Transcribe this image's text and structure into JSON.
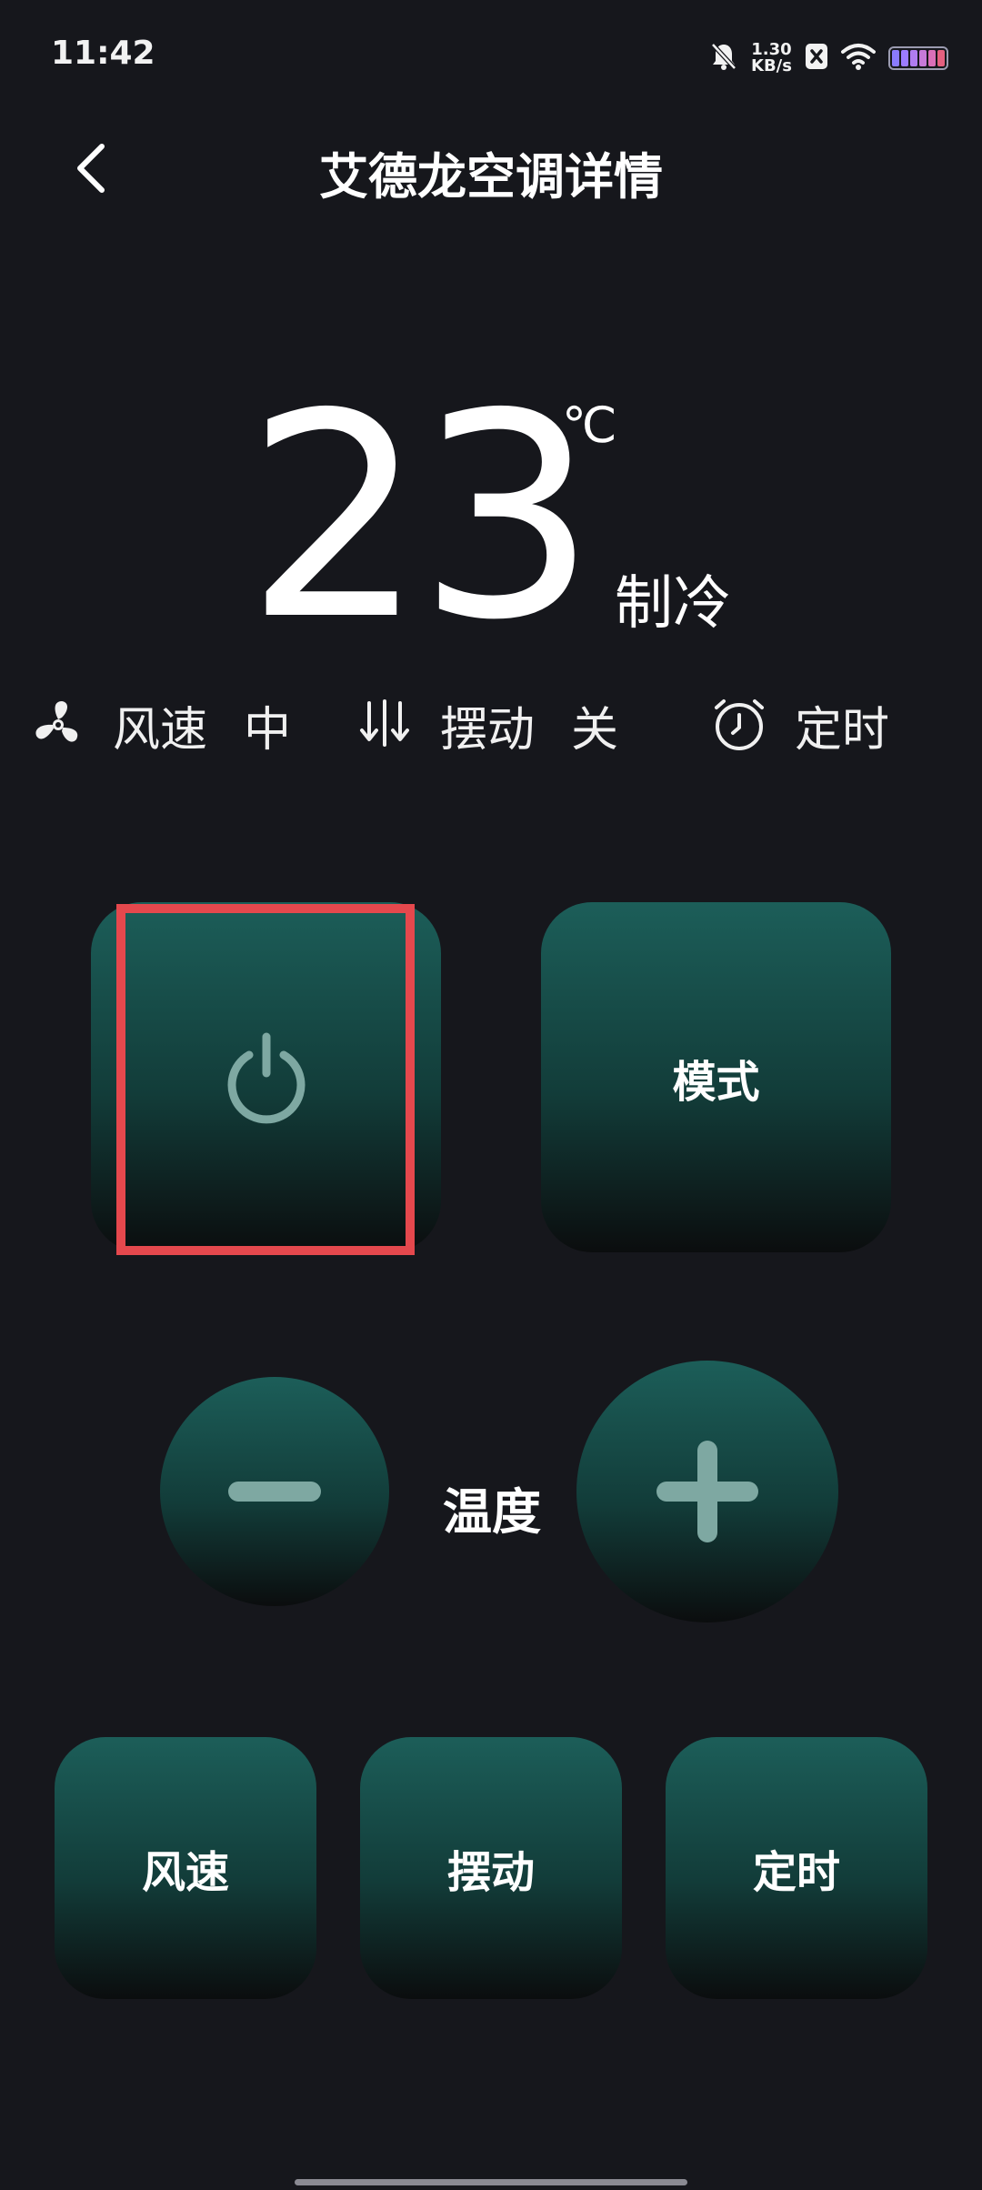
{
  "status_bar": {
    "time": "11:42",
    "net_speed_value": "1.30",
    "net_speed_unit": "KB/s",
    "battery_colors": [
      "#8a7bff",
      "#9c7cff",
      "#b07cf0",
      "#c77ad8",
      "#da6fb8",
      "#e4607f"
    ]
  },
  "header": {
    "title": "艾德龙空调详情"
  },
  "ac_status": {
    "temperature": "23",
    "unit": "℃",
    "mode": "制冷"
  },
  "info_row": {
    "fan_label": "风速",
    "fan_value": "中",
    "swing_label": "摆动",
    "swing_value": "关",
    "timer_label": "定时"
  },
  "controls": {
    "mode_button": "模式",
    "temp_label": "温度",
    "fan_button": "风速",
    "swing_button": "摆动",
    "timer_button": "定时"
  },
  "theme": {
    "background": "#16171c",
    "button_top": "#1c5e59",
    "icon_color": "#7ea8a2",
    "highlight": "#e5484d"
  }
}
